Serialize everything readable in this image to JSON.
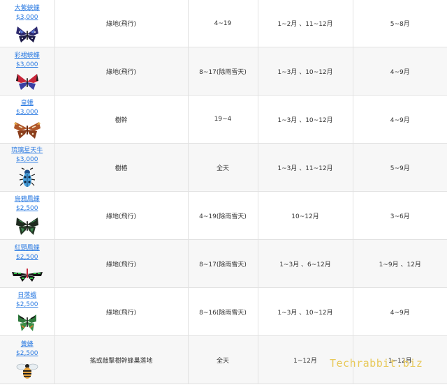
{
  "rows": [
    {
      "name": "大紫蛺蝶",
      "price": "$3,000",
      "location": "綠地(飛行)",
      "time": "4~19",
      "north": "1~2月 、11~12月",
      "south": "5~8月",
      "icon": "purple-emperor-butterfly-icon"
    },
    {
      "name": "彩裙蛺蝶",
      "price": "$3,000",
      "location": "綠地(飛行)",
      "time": "8~17(除雨雪天)",
      "north": "1~3月 、10~12月",
      "south": "4~9月",
      "icon": "agrias-butterfly-icon"
    },
    {
      "name": "皇蛾",
      "price": "$3,000",
      "location": "樹幹",
      "time": "19~4",
      "north": "1~3月 、10~12月",
      "south": "4~9月",
      "icon": "atlas-moth-icon"
    },
    {
      "name": "琉璃星天牛",
      "price": "$3,000",
      "location": "樹樁",
      "time": "全天",
      "north": "1~3月 、11~12月",
      "south": "5~9月",
      "icon": "rosalia-beetle-icon"
    },
    {
      "name": "烏鴉鳳蝶",
      "price": "$2,500",
      "location": "綠地(飛行)",
      "time": "4~19(除雨雪天)",
      "north": "10~12月",
      "south": "3~6月",
      "icon": "peacock-butterfly-icon"
    },
    {
      "name": "紅頸鳳蝶",
      "price": "$2,500",
      "location": "綠地(飛行)",
      "time": "8~17(除雨雪天)",
      "north": "1~3月 、6~12月",
      "south": "1~9月 、12月",
      "icon": "rajah-birdwing-icon"
    },
    {
      "name": "日落蛾",
      "price": "$2,500",
      "location": "綠地(飛行)",
      "time": "8~16(除雨雪天)",
      "north": "1~3月 、10~12月",
      "south": "4~9月",
      "icon": "sunset-moth-icon"
    },
    {
      "name": "黃蜂",
      "price": "$2,500",
      "location": "搖或敲擊樹幹蜂巢落地",
      "time": "全天",
      "north": "1~12月",
      "south": "1~12月",
      "icon": "wasp-icon"
    }
  ],
  "watermark": "Techrabbit.biz"
}
